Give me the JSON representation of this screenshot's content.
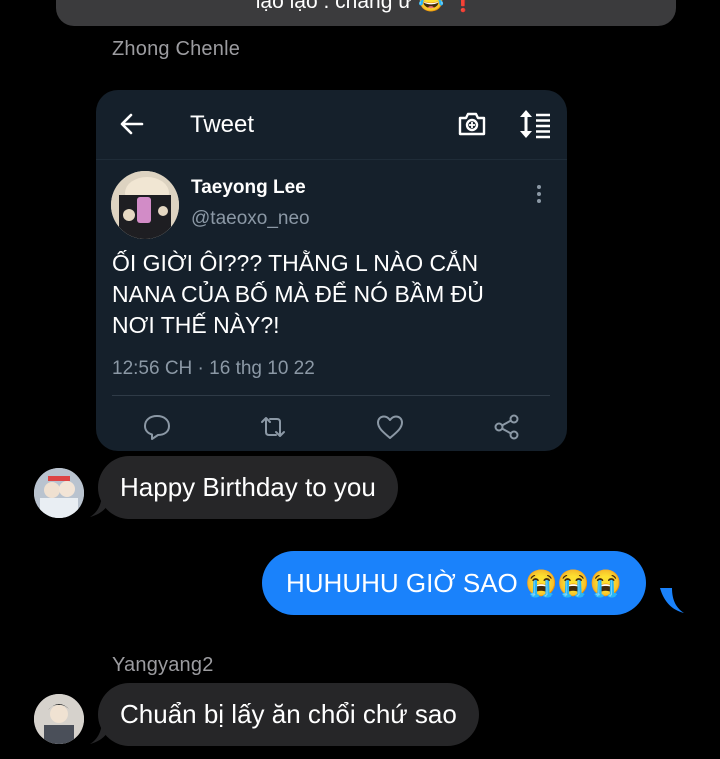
{
  "top_message": {
    "text": "lạo lạo . chắng ư 😂 ❗"
  },
  "group1": {
    "sender": "Zhong Chenle"
  },
  "tweet": {
    "header_title": "Tweet",
    "author_name": "Taeyong Lee",
    "author_handle": "@taeoxo_neo",
    "text": "ỐI GIỜI ÔI??? THẰNG L NÀO CẮN NANA CỦA BỐ MÀ ĐỂ NÓ BẦM ĐỦ NƠI THẾ NÀY?!",
    "timestamp": "12:56 CH · 16 thg 10 22"
  },
  "messages": {
    "incoming_1": "Happy Birthday to you",
    "outgoing_1": "HUHUHU GIỜ SAO 😭😭😭",
    "incoming_2": "Chuẩn bị lấy ăn chổi chứ sao"
  },
  "group2": {
    "sender": "Yangyang2"
  },
  "colors": {
    "background": "#000000",
    "incoming_bubble": "#262628",
    "outgoing_bubble": "#1a82fb",
    "tweet_card": "#15202b",
    "secondary_text": "#8b98a5"
  },
  "icons": [
    "back-arrow-icon",
    "camera-icon",
    "sort-icon",
    "more-vertical-icon",
    "reply-icon",
    "retweet-icon",
    "like-icon",
    "share-icon"
  ]
}
